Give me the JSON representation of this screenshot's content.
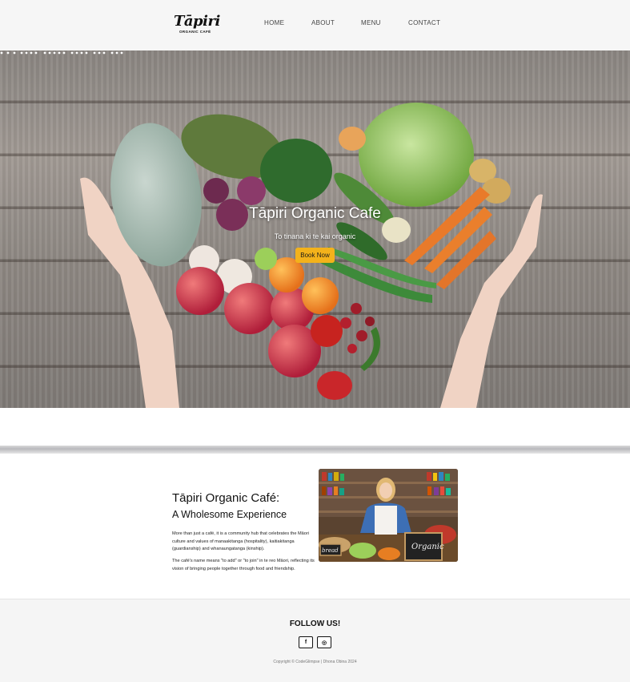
{
  "header": {
    "logo_main": "Tāpiri",
    "logo_sub": "ORGANIC CAFÉ",
    "nav": [
      {
        "label": "HOME"
      },
      {
        "label": "ABOUT"
      },
      {
        "label": "MENU"
      },
      {
        "label": "CONTACT"
      }
    ]
  },
  "hero": {
    "title": "Tāpiri Organic Cafe",
    "subtitle": "To tinana ki te kai organic",
    "button_label": "Book Now"
  },
  "about": {
    "title_line1": "Tāpiri Organic Café:",
    "title_line2": "A Wholesome Experience",
    "paragraph1": "More than just a café, it is a community hub that celebrates the Māori culture and values of manaakitanga (hospitality), kaitiakitanga (guardianship) and whanaungatanga (kinship).",
    "paragraph2": "The café's name means \"to add\" or \"to join\" in te reo Māori, reflecting its vision of bringing people together through food and friendship.",
    "image_sign_left": "bread",
    "image_sign_right": "Organic"
  },
  "footer": {
    "follow_label": "FOLLOW US!",
    "social": [
      {
        "name": "facebook",
        "glyph": "f"
      },
      {
        "name": "instagram",
        "glyph": "◎"
      }
    ],
    "copyright": "Copyright © CodeGlimpse | Dhona Obina 2024"
  },
  "colors": {
    "accent": "#f3b21b",
    "header_bg": "#f6f6f6",
    "footer_bg": "#f5f5f5"
  }
}
